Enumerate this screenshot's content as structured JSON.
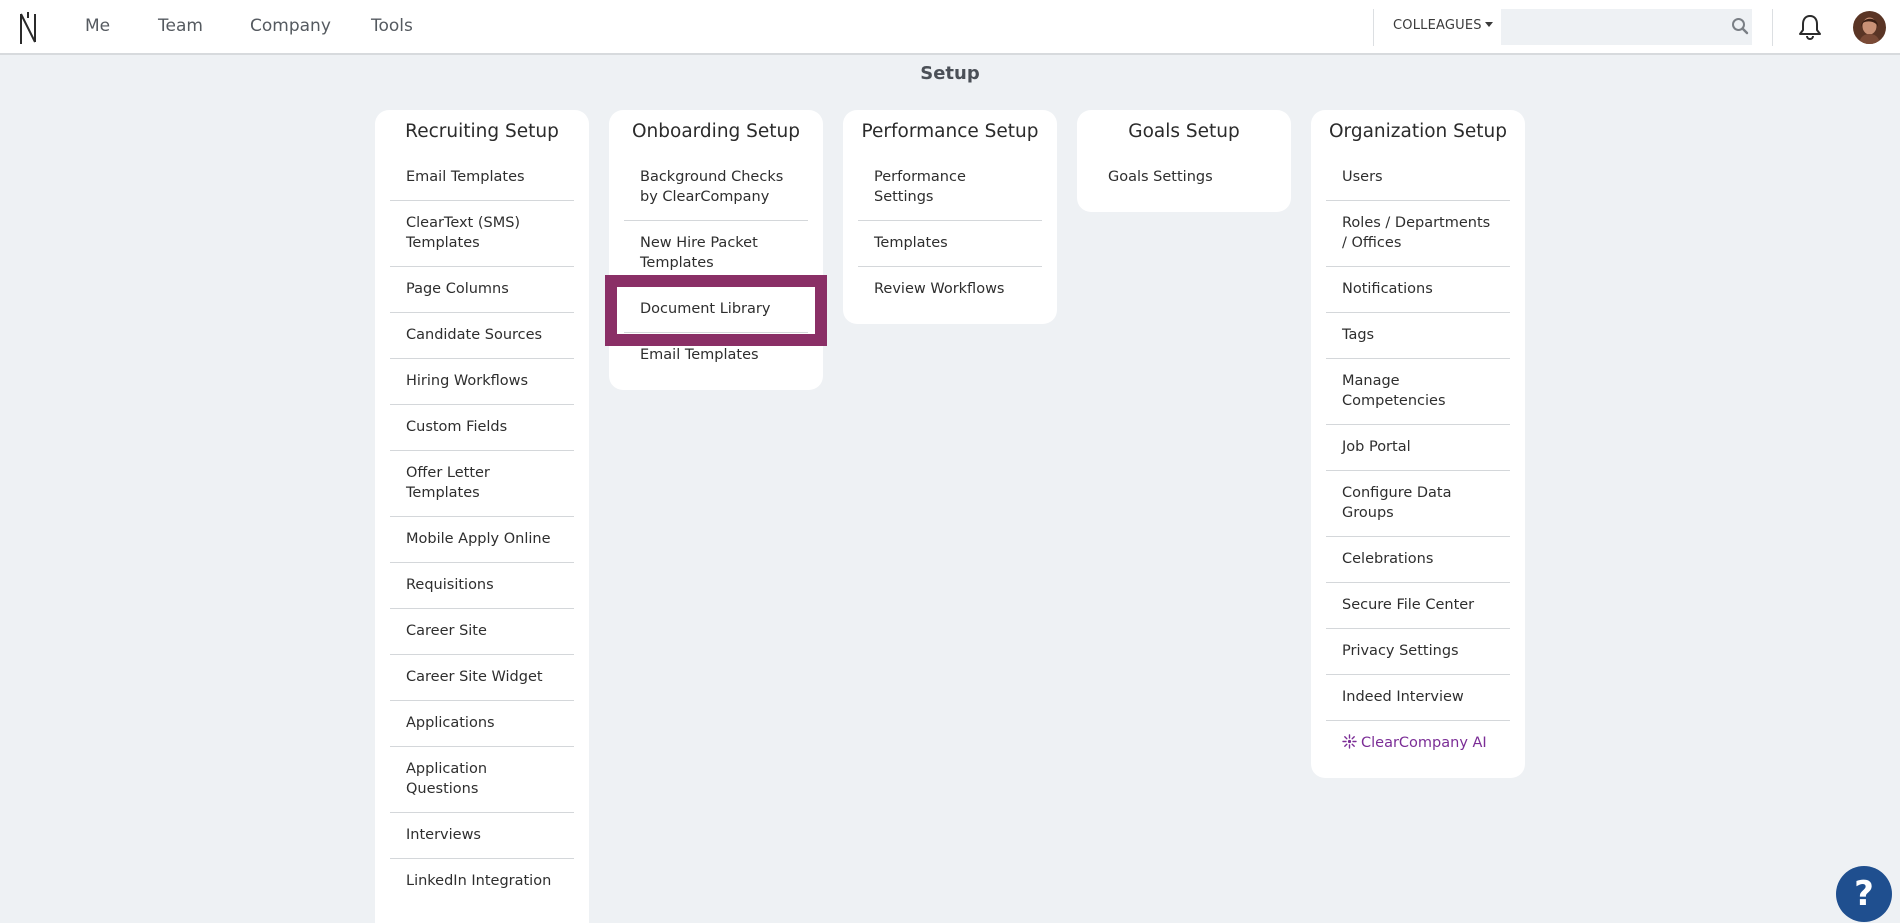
{
  "nav": {
    "items": [
      "Me",
      "Team",
      "Company",
      "Tools"
    ],
    "colleagues_label": "COLLEAGUES",
    "search_placeholder": ""
  },
  "page": {
    "title": "Setup"
  },
  "cards": [
    {
      "title": "Recruiting Setup",
      "items": [
        "Email Templates",
        "ClearText (SMS) Templates",
        "Page Columns",
        "Candidate Sources",
        "Hiring Workflows",
        "Custom Fields",
        "Offer Letter Templates",
        "Mobile Apply Online",
        "Requisitions",
        "Career Site",
        "Career Site Widget",
        "Applications",
        "Application Questions",
        "Interviews",
        "LinkedIn Integration"
      ]
    },
    {
      "title": "Onboarding Setup",
      "items": [
        "Background Checks by ClearCompany",
        "New Hire Packet Templates",
        "Document Library",
        "Email Templates"
      ],
      "highlighted_item": "Document Library"
    },
    {
      "title": "Performance Setup",
      "items": [
        "Performance Settings",
        "Templates",
        "Review Workflows"
      ]
    },
    {
      "title": "Goals Setup",
      "items": [
        "Goals Settings"
      ]
    },
    {
      "title": "Organization Setup",
      "items": [
        "Users",
        "Roles / Departments / Offices",
        "Notifications",
        "Tags",
        "Manage Competencies",
        "Job Portal",
        "Configure Data Groups",
        "Celebrations",
        "Secure File Center",
        "Privacy Settings",
        "Indeed Interview",
        "ClearCompany AI"
      ]
    }
  ],
  "help": {
    "label": "?"
  },
  "colors": {
    "highlight": "#8a2f66",
    "ai_link": "#7b2d96",
    "help_button": "#1f4f8f",
    "page_background": "#eef1f4"
  },
  "icons": [
    "brand-logo-icon",
    "search-icon",
    "bell-icon",
    "sparkle-icon",
    "help-icon"
  ]
}
